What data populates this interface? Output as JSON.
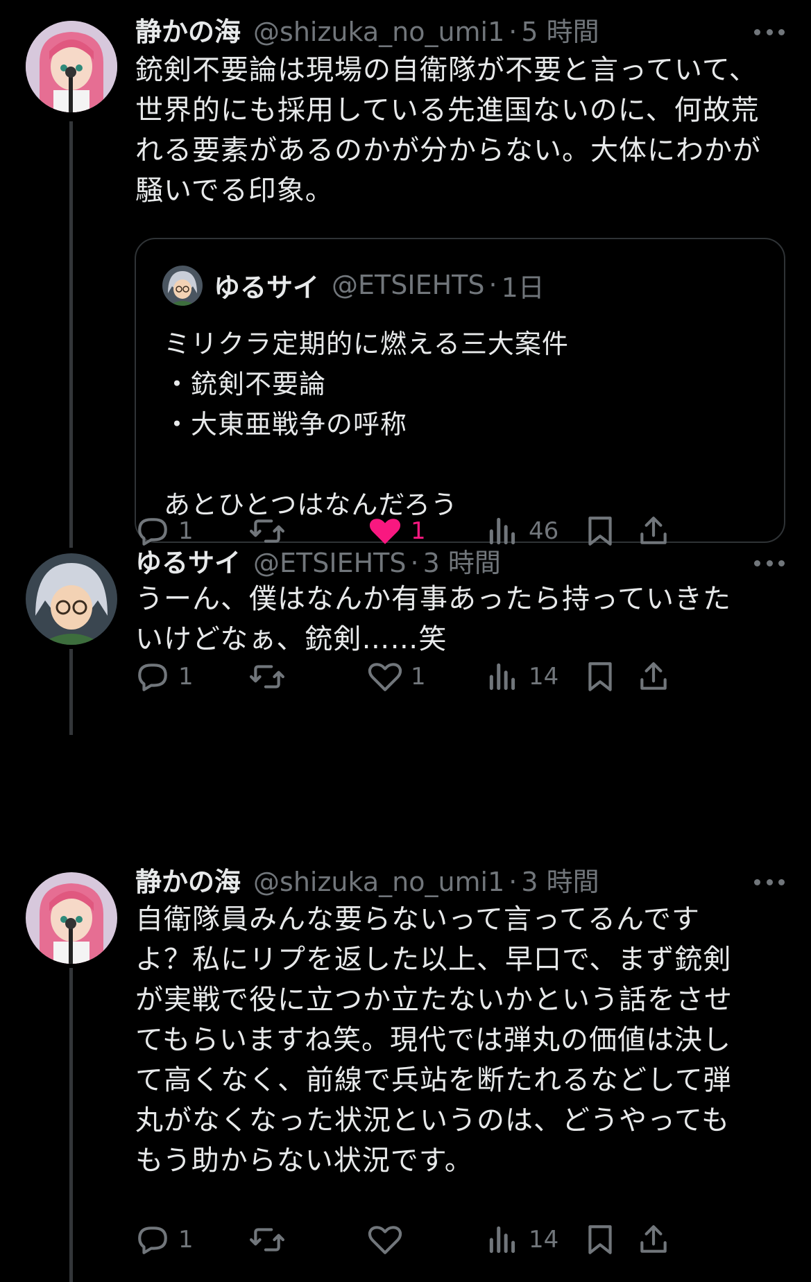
{
  "tweets": [
    {
      "name": "静かの海",
      "handle": "@shizuka_no_umi1",
      "dot": "·",
      "time": "5 時間",
      "text": "銃剣不要論は現場の自衛隊が不要と言っていて、\n世界的にも採用している先進国ないのに、何故荒\nれる要素があるのかが分からない。大体にわかが\n騒いでる印象。",
      "quote": {
        "name": "ゆるサイ",
        "handle": "@ETSIEHTS",
        "dot": "·",
        "time": "1日",
        "text": "ミリクラ定期的に燃える三大案件\n・銃剣不要論\n・大東亜戦争の呼称\n\nあとひとつはなんだろう"
      },
      "replies": "1",
      "retweets": "",
      "likes": "1",
      "liked": true,
      "views": "46"
    },
    {
      "name": "ゆるサイ",
      "handle": "@ETSIEHTS",
      "dot": "·",
      "time": "3 時間",
      "text": "うーん、僕はなんか有事あったら持っていきた\nいけどなぁ、銃剣……笑",
      "replies": "1",
      "retweets": "",
      "likes": "1",
      "liked": false,
      "views": "14"
    },
    {
      "name": "静かの海",
      "handle": "@shizuka_no_umi1",
      "dot": "·",
      "time": "3 時間",
      "text": "自衛隊員みんな要らないって言ってるんです\nよ？私にリプを返した以上、早口で、まず銃剣\nが実戦で役に立つか立たないかという話をさせ\nてもらいますね笑。現代では弾丸の価値は決し\nて高くなく、前線で兵站を断たれるなどして弾\n丸がなくなった状況というのは、どうやっても\nもう助からない状況です。",
      "replies": "1",
      "retweets": "",
      "likes": "",
      "liked": false,
      "views": "14"
    }
  ],
  "colors": {
    "background": "#000000",
    "text": "#e7e9ea",
    "muted": "#71767b",
    "like": "#f91880",
    "border": "#2f3336"
  }
}
